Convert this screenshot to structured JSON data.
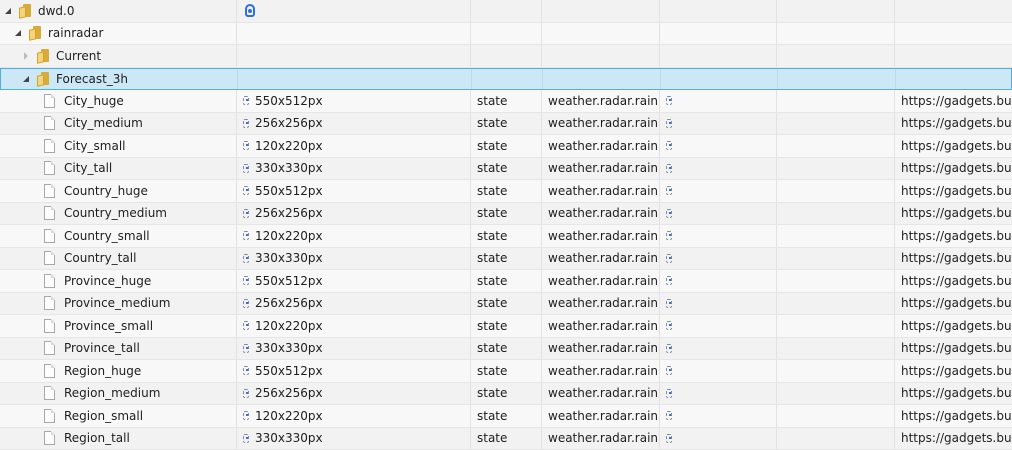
{
  "tree": {
    "root": {
      "label": "dwd.0",
      "icon": "adapter-icon"
    },
    "rainradar": {
      "label": "rainradar"
    },
    "current": {
      "label": "Current"
    },
    "forecast": {
      "label": "Forecast_3h"
    },
    "states": [
      {
        "name": "City_huge",
        "value": "550x512px",
        "type": "state",
        "role": "weather.radar.rain",
        "url": "https://gadgets.buien"
      },
      {
        "name": "City_medium",
        "value": "256x256px",
        "type": "state",
        "role": "weather.radar.rain",
        "url": "https://gadgets.buien"
      },
      {
        "name": "City_small",
        "value": "120x220px",
        "type": "state",
        "role": "weather.radar.rain",
        "url": "https://gadgets.buien"
      },
      {
        "name": "City_tall",
        "value": "330x330px",
        "type": "state",
        "role": "weather.radar.rain",
        "url": "https://gadgets.buien"
      },
      {
        "name": "Country_huge",
        "value": "550x512px",
        "type": "state",
        "role": "weather.radar.rain",
        "url": "https://gadgets.buien"
      },
      {
        "name": "Country_medium",
        "value": "256x256px",
        "type": "state",
        "role": "weather.radar.rain",
        "url": "https://gadgets.buien"
      },
      {
        "name": "Country_small",
        "value": "120x220px",
        "type": "state",
        "role": "weather.radar.rain",
        "url": "https://gadgets.buien"
      },
      {
        "name": "Country_tall",
        "value": "330x330px",
        "type": "state",
        "role": "weather.radar.rain",
        "url": "https://gadgets.buien"
      },
      {
        "name": "Province_huge",
        "value": "550x512px",
        "type": "state",
        "role": "weather.radar.rain",
        "url": "https://gadgets.buien"
      },
      {
        "name": "Province_medium",
        "value": "256x256px",
        "type": "state",
        "role": "weather.radar.rain",
        "url": "https://gadgets.buien"
      },
      {
        "name": "Province_small",
        "value": "120x220px",
        "type": "state",
        "role": "weather.radar.rain",
        "url": "https://gadgets.buien"
      },
      {
        "name": "Province_tall",
        "value": "330x330px",
        "type": "state",
        "role": "weather.radar.rain",
        "url": "https://gadgets.buien"
      },
      {
        "name": "Region_huge",
        "value": "550x512px",
        "type": "state",
        "role": "weather.radar.rain",
        "url": "https://gadgets.buien"
      },
      {
        "name": "Region_medium",
        "value": "256x256px",
        "type": "state",
        "role": "weather.radar.rain",
        "url": "https://gadgets.buien"
      },
      {
        "name": "Region_small",
        "value": "120x220px",
        "type": "state",
        "role": "weather.radar.rain",
        "url": "https://gadgets.buien"
      },
      {
        "name": "Region_tall",
        "value": "330x330px",
        "type": "state",
        "role": "weather.radar.rain",
        "url": "https://gadgets.buien"
      }
    ]
  },
  "colors": {
    "selected_bg": "#cce8f7",
    "selected_border": "#4fb0dd",
    "folder": "#f6d57a",
    "adapter_icon": "#2f6fd7"
  }
}
